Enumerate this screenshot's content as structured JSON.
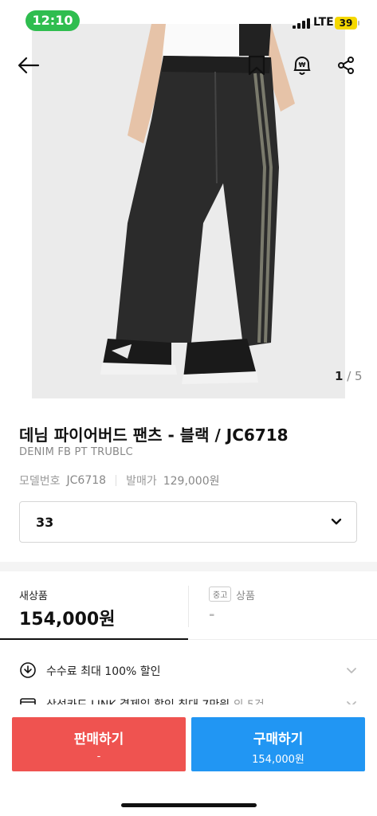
{
  "status_bar": {
    "time": "12:10",
    "network": "LTE",
    "battery": "39"
  },
  "gallery": {
    "current": "1",
    "separator": " / ",
    "total": "5"
  },
  "product": {
    "title": "데님 파이어버드 팬츠 - 블랙 / JC6718",
    "subtitle": "DENIM FB PT TRUBLC",
    "model_label": "모델번호",
    "model_value": "JC6718",
    "release_label": "발매가",
    "release_value": "129,000원"
  },
  "size_selector": {
    "value": "33"
  },
  "price_tabs": {
    "new": {
      "label": "새상품",
      "price": "154,000원"
    },
    "used": {
      "badge": "중고",
      "label": "상품",
      "price": "-"
    }
  },
  "benefits": [
    {
      "text": "수수료 최대 100% 할인",
      "muted": ""
    },
    {
      "text": "삼성카드 LINK 결제일 할인 최대 7만원",
      "muted": " 외 5건"
    }
  ],
  "actions": {
    "sell": {
      "label": "판매하기",
      "price": "-"
    },
    "buy": {
      "label": "구매하기",
      "price": "154,000원"
    }
  },
  "colors": {
    "sell": "#ef5350",
    "buy": "#2196f3",
    "time_pill": "#2fbd4f"
  }
}
